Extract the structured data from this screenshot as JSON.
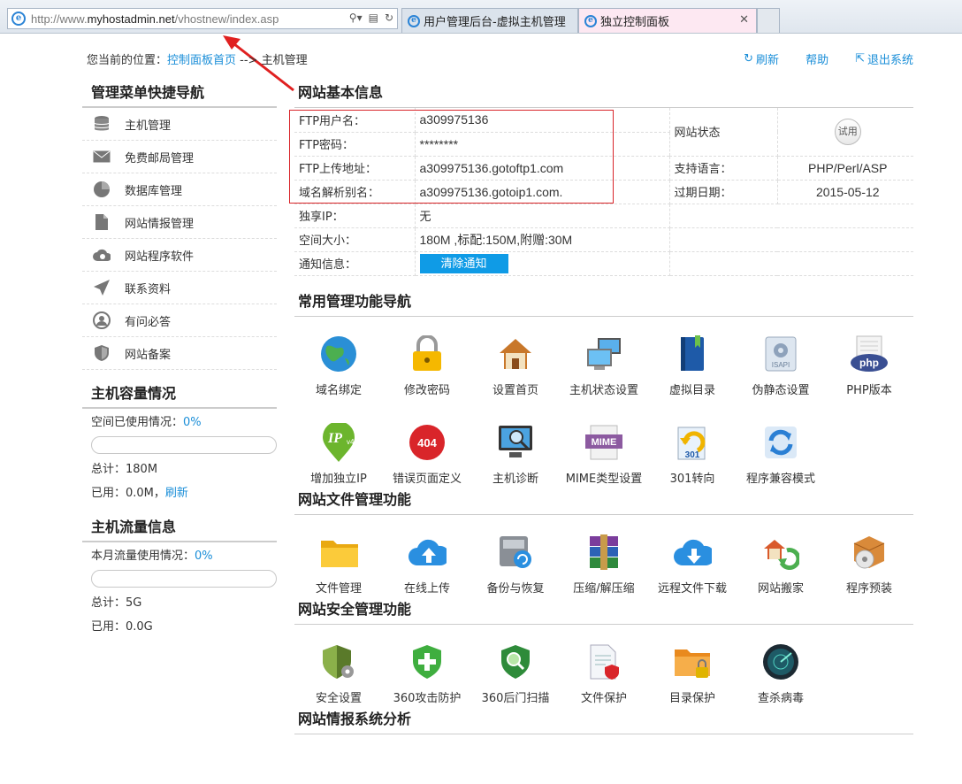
{
  "browser": {
    "url_prefix": "http://www.",
    "url_host": "myhostadmin.net",
    "url_path": "/vhostnew/index.asp",
    "tabs": [
      {
        "label": "用户管理后台-虚拟主机管理"
      },
      {
        "label": "独立控制面板"
      }
    ]
  },
  "breadcrumb": {
    "prefix": "您当前的位置：",
    "link": "控制面板首页",
    "sep": " --> ",
    "current": "主机管理"
  },
  "toplinks": {
    "refresh": "刷新",
    "help": "帮助",
    "logout": "退出系统"
  },
  "left": {
    "nav_title": "管理菜单快捷导航",
    "nav_items": [
      {
        "label": "主机管理",
        "icon": "database-icon"
      },
      {
        "label": "免费邮局管理",
        "icon": "mail-icon"
      },
      {
        "label": "数据库管理",
        "icon": "pie-icon"
      },
      {
        "label": "网站情报管理",
        "icon": "document-icon"
      },
      {
        "label": "网站程序软件",
        "icon": "cloud-icon"
      },
      {
        "label": "联系资料",
        "icon": "send-icon"
      },
      {
        "label": "有问必答",
        "icon": "user-icon"
      },
      {
        "label": "网站备案",
        "icon": "shield-icon"
      }
    ],
    "capacity": {
      "title": "主机容量情况",
      "used_label": "空间已使用情况：",
      "used_pct": "0%",
      "used_fraction": 0,
      "total": "总计：180M",
      "used": "已用：0.0M，",
      "refresh": "刷新"
    },
    "traffic": {
      "title": "主机流量信息",
      "used_label": "本月流量使用情况：",
      "used_pct": "0%",
      "used_fraction": 0,
      "total": "总计：5G",
      "used": "已用：0.0G"
    }
  },
  "site_info": {
    "title": "网站基本信息",
    "rows": [
      {
        "k": "FTP用户名：",
        "v": "a309975136",
        "k2": "网站状态",
        "v2": ""
      },
      {
        "k": "FTP密码：",
        "v": "********",
        "k2": "",
        "v2": ""
      },
      {
        "k": "FTP上传地址：",
        "v": "a309975136.gotoftp1.com",
        "k2": "支持语言：",
        "v2": "PHP/Perl/ASP"
      },
      {
        "k": "域名解析别名：",
        "v": "a309975136.gotoip1.com.",
        "k2": "过期日期：",
        "v2": "2015-05-12"
      },
      {
        "k": "独享IP：",
        "v": "无"
      },
      {
        "k": "空间大小：",
        "v": "180M ,标配:150M,附赠:30M"
      },
      {
        "k": "通知信息：",
        "v": ""
      }
    ],
    "status_badge": "试用",
    "clear_notice": "清除通知"
  },
  "common_nav": {
    "title": "常用管理功能导航",
    "items": [
      {
        "label": "域名绑定"
      },
      {
        "label": "修改密码"
      },
      {
        "label": "设置首页"
      },
      {
        "label": "主机状态设置"
      },
      {
        "label": "虚拟目录"
      },
      {
        "label": "伪静态设置"
      },
      {
        "label": "PHP版本"
      },
      {
        "label": "增加独立IP"
      },
      {
        "label": "错误页面定义"
      },
      {
        "label": "主机诊断"
      },
      {
        "label": "MIME类型设置"
      },
      {
        "label": "301转向"
      },
      {
        "label": "程序兼容模式"
      }
    ],
    "icon_text": {
      "php": "php",
      "ipv4": "IP",
      "ipv4_sub": "v4",
      "e404": "404",
      "mime": "MIME",
      "r301": "301",
      "isapi": "ISAPI"
    }
  },
  "file_mgmt": {
    "title": "网站文件管理功能",
    "items": [
      {
        "label": "文件管理"
      },
      {
        "label": "在线上传"
      },
      {
        "label": "备份与恢复"
      },
      {
        "label": "压缩/解压缩"
      },
      {
        "label": "远程文件下载"
      },
      {
        "label": "网站搬家"
      },
      {
        "label": "程序预装"
      }
    ]
  },
  "security": {
    "title": "网站安全管理功能",
    "items": [
      {
        "label": "安全设置"
      },
      {
        "label": "360攻击防护"
      },
      {
        "label": "360后门扫描"
      },
      {
        "label": "文件保护"
      },
      {
        "label": "目录保护"
      },
      {
        "label": "查杀病毒"
      }
    ]
  },
  "cut_title": "网站情报系统分析"
}
